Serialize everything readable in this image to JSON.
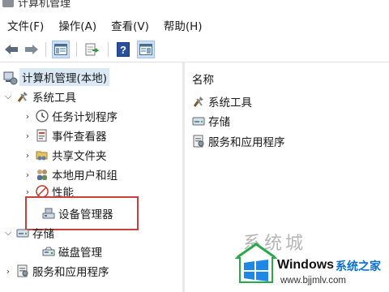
{
  "window": {
    "title": "计算机管理"
  },
  "menu": [
    "文件(F)",
    "操作(A)",
    "查看(V)",
    "帮助(H)"
  ],
  "toolbar": {
    "buttons": [
      "back-icon",
      "forward-icon",
      "show-tree-icon",
      "export-icon",
      "help-icon",
      "properties-icon"
    ]
  },
  "tree": {
    "root": "计算机管理(本地)",
    "system_tools": "系统工具",
    "items": [
      "任务计划程序",
      "事件查看器",
      "共享文件夹",
      "本地用户和组",
      "性能",
      "设备管理器"
    ],
    "storage": "存储",
    "disk_management": "磁盘管理",
    "services": "服务和应用程序"
  },
  "right_pane": {
    "column_header": "名称",
    "items": [
      "系统工具",
      "存储",
      "服务和应用程序"
    ]
  },
  "watermark": {
    "cn_text": "系统之家",
    "brand": "Windows",
    "url": "www.bjjmlv.com",
    "top_text": "系统城"
  },
  "colors": {
    "selection": "#dbe9f7",
    "highlight_box": "#c9403e",
    "brand_blue": "#0a6fd0"
  }
}
